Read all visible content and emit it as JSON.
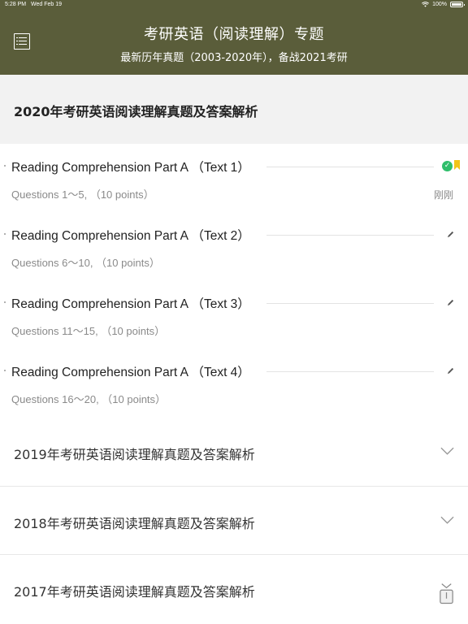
{
  "status_bar": {
    "time": "5:28 PM",
    "date": "Wed Feb 19",
    "battery": "100%"
  },
  "header": {
    "title": "考研英语（阅读理解）专题",
    "subtitle": "最新历年真题（2003-2020年），备战2021考研"
  },
  "open_section": {
    "title": "2020年考研英语阅读理解真题及答案解析",
    "items": [
      {
        "title": "Reading Comprehension Part A （Text 1）",
        "sub": "Questions 1～5, （10 points）",
        "badge": "刚刚",
        "completed": true
      },
      {
        "title": "Reading Comprehension Part A （Text 2）",
        "sub": "Questions 6～10, （10 points）"
      },
      {
        "title": "Reading Comprehension Part A （Text 3）",
        "sub": "Questions 11～15, （10 points）"
      },
      {
        "title": "Reading Comprehension Part A （Text 4）",
        "sub": "Questions 16～20, （10 points）"
      }
    ]
  },
  "sections": [
    {
      "title": "2019年考研英语阅读理解真题及答案解析"
    },
    {
      "title": "2018年考研英语阅读理解真题及答案解析"
    },
    {
      "title": "2017年考研英语阅读理解真题及答案解析"
    }
  ],
  "icons": {
    "menu": "menu-list-icon",
    "check": "check-circle-icon",
    "bookmark": "bookmark-icon",
    "pen": "pen-icon",
    "chevron": "chevron-down-icon",
    "share": "share-icon"
  },
  "colors": {
    "header": "#5a5d3a",
    "check": "#2fbe6b",
    "bookmark": "#f2c418"
  }
}
